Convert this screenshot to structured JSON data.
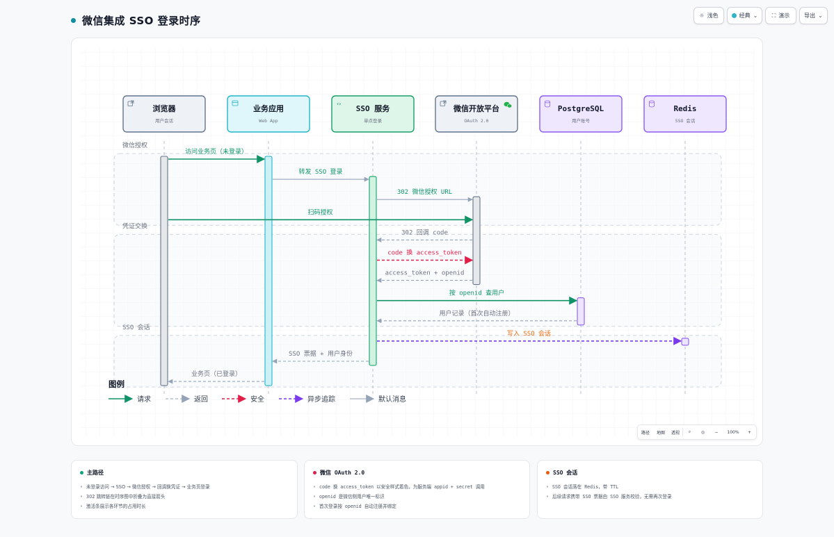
{
  "header": {
    "title": "微信集成 SSO 登录时序",
    "toolbar": {
      "theme_label": "浅色",
      "style_label": "经典",
      "present_label": "演示",
      "export_label": "导出"
    }
  },
  "diagram": {
    "participants": [
      {
        "id": "browser",
        "name": "浏览器",
        "sub": "用户会话",
        "icon": "external-link-icon",
        "fill": "#eef1f5",
        "stroke": "#64748b",
        "act_fill": "#e5e7eb",
        "act_stroke": "#64748b"
      },
      {
        "id": "app",
        "name": "业务应用",
        "sub": "Web App",
        "icon": "browser-window-icon",
        "fill": "#dff7fb",
        "stroke": "#22b5c9",
        "act_fill": "#ccf2f8",
        "act_stroke": "#22b5c9"
      },
      {
        "id": "sso",
        "name": "SSO 服务",
        "sub": "单点登录",
        "icon": "code-icon",
        "fill": "#ddf6e9",
        "stroke": "#16a06a",
        "act_fill": "#d1f3e1",
        "act_stroke": "#16a06a"
      },
      {
        "id": "wechat",
        "name": "微信开放平台",
        "sub": "OAuth 2.0",
        "icon": "external-link-icon",
        "fill": "#eef1f5",
        "stroke": "#64748b",
        "act_fill": "#e5e7eb",
        "act_stroke": "#64748b",
        "badge": "wechat-logo-icon"
      },
      {
        "id": "pg",
        "name": "PostgreSQL",
        "sub": "用户账号",
        "icon": "database-icon",
        "fill": "#efe7fd",
        "stroke": "#8b5cf6",
        "act_fill": "#ede4fe",
        "act_stroke": "#8b5cf6"
      },
      {
        "id": "redis",
        "name": "Redis",
        "sub": "SSO 会话",
        "icon": "database-icon",
        "fill": "#efe7fd",
        "stroke": "#8b5cf6",
        "act_fill": "#ede4fe",
        "act_stroke": "#8b5cf6"
      }
    ],
    "groups": [
      {
        "label": "微信授权",
        "from_msg": 0,
        "to_msg": 3
      },
      {
        "label": "凭证交换",
        "from_msg": 4,
        "to_msg": 8
      },
      {
        "label": "SSO 会话",
        "from_msg": 9,
        "to_msg": 11
      }
    ],
    "messages": [
      {
        "from": "browser",
        "to": "app",
        "label": "访问业务页（未登录）",
        "kind": "request"
      },
      {
        "from": "app",
        "to": "sso",
        "label": "转发 SSO 登录",
        "kind": "default"
      },
      {
        "from": "sso",
        "to": "wechat",
        "label": "302 微信授权 URL",
        "kind": "default"
      },
      {
        "from": "browser",
        "to": "wechat",
        "label": "扫码授权",
        "kind": "request"
      },
      {
        "from": "wechat",
        "to": "sso",
        "label": "302 回调 code",
        "kind": "return"
      },
      {
        "from": "sso",
        "to": "wechat",
        "label": "code 换 access_token",
        "kind": "secure"
      },
      {
        "from": "wechat",
        "to": "sso",
        "label": "access_token + openid",
        "kind": "return"
      },
      {
        "from": "sso",
        "to": "pg",
        "label": "按 openid 查用户",
        "kind": "request"
      },
      {
        "from": "pg",
        "to": "sso",
        "label": "用户记录（首次自动注册）",
        "kind": "return"
      },
      {
        "from": "sso",
        "to": "redis",
        "label": "写入 SSO 会话",
        "kind": "async"
      },
      {
        "from": "sso",
        "to": "app",
        "label": "SSO 票据 + 用户身份",
        "kind": "return"
      },
      {
        "from": "app",
        "to": "browser",
        "label": "业务页（已登录）",
        "kind": "return"
      }
    ],
    "activations": [
      {
        "participant": "browser",
        "from_msg": 0,
        "to_msg": 11
      },
      {
        "participant": "app",
        "from_msg": 0,
        "to_msg": 11
      },
      {
        "participant": "sso",
        "from_msg": 1,
        "to_msg": 10
      },
      {
        "participant": "wechat",
        "from_msg": 2,
        "to_msg": 6
      },
      {
        "participant": "pg",
        "from_msg": 7,
        "to_msg": 8
      },
      {
        "participant": "redis",
        "from_msg": 9,
        "to_msg": 9
      }
    ],
    "styles": {
      "request": {
        "color": "#109467",
        "dashed": false,
        "label_color": "#109467"
      },
      "return": {
        "color": "#94a3b8",
        "dashed": true,
        "label_color": "#6b7280"
      },
      "secure": {
        "color": "#e11d48",
        "dashed": true,
        "label_color": "#e11d48"
      },
      "async": {
        "color": "#7c3aed",
        "dashed": true,
        "label_color": "#ea6a12"
      },
      "default": {
        "color": "#94a3b8",
        "dashed": false,
        "label_color": "#109467"
      }
    },
    "legend": {
      "title": "图例",
      "items": [
        {
          "kind": "request",
          "label": "请求"
        },
        {
          "kind": "return",
          "label": "返回"
        },
        {
          "kind": "secure",
          "label": "安全"
        },
        {
          "kind": "async",
          "label": "异步追踪"
        },
        {
          "kind": "default",
          "label": "默认消息"
        }
      ]
    }
  },
  "zoom": {
    "items": [
      "路径",
      "地图",
      "透视"
    ],
    "level": "100%",
    "minus": "−",
    "plus": "+"
  },
  "cards": [
    {
      "title": "主路径",
      "color": "#10a37f",
      "items": [
        "未登录访问 → SSO → 微信授权 → 回调换凭证 → 业务页登录",
        "302 跳转链在时序图中折叠为直接箭头",
        "激活条展示各环节的占用时长"
      ]
    },
    {
      "title": "微信 OAuth 2.0",
      "color": "#e11d48",
      "items": [
        "code 换 access_token 以安全样式着色，为服务端 appid + secret 调用",
        "openid 是微信侧用户唯一标识",
        "首次登录按 openid 自动注册并绑定"
      ]
    },
    {
      "title": "SSO 会话",
      "color": "#ea580c",
      "items": [
        "SSO 会话落在 Redis，带 TTL",
        "后续请求携带 SSO 票据由 SSO 服务校验，无需再次登录"
      ]
    }
  ]
}
